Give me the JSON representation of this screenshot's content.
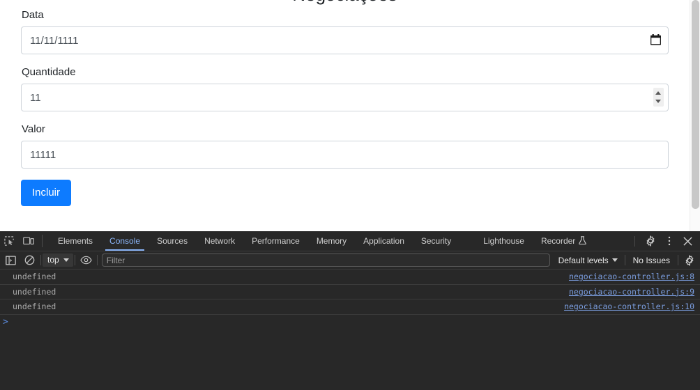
{
  "page": {
    "title": "Negociações",
    "form": {
      "fields": [
        {
          "label": "Data",
          "value": "11/11/1111",
          "icon": "calendar-icon",
          "type": "date"
        },
        {
          "label": "Quantidade",
          "value": "11",
          "icon": "spinner-icon",
          "type": "number"
        },
        {
          "label": "Valor",
          "value": "11111",
          "icon": "",
          "type": "text"
        }
      ],
      "submit_label": "Incluir",
      "submit_color": "#0d7bff"
    }
  },
  "devtools": {
    "left_icons": [
      {
        "name": "inspect-element-icon"
      },
      {
        "name": "device-toolbar-icon"
      }
    ],
    "tabs": [
      {
        "label": "Elements",
        "active": false
      },
      {
        "label": "Console",
        "active": true
      },
      {
        "label": "Sources",
        "active": false
      },
      {
        "label": "Network",
        "active": false
      },
      {
        "label": "Performance",
        "active": false
      },
      {
        "label": "Memory",
        "active": false
      },
      {
        "label": "Application",
        "active": false
      },
      {
        "label": "Security",
        "active": false
      },
      {
        "label": "Lighthouse",
        "active": false
      },
      {
        "label": "Recorder",
        "active": false,
        "badge": "flask-icon"
      }
    ],
    "tabbar_right_icons": [
      {
        "name": "settings-gear-icon"
      },
      {
        "name": "more-options-icon"
      },
      {
        "name": "close-devtools-icon"
      }
    ],
    "toolbar": {
      "sidebar_toggle": "console-sidebar-icon",
      "clear_console": "clear-console-icon",
      "context": "top",
      "live_expression": "eye-icon",
      "filter_placeholder": "Filter",
      "filter_value": "",
      "levels_label": "Default levels",
      "issues_label": "No Issues",
      "issues_gear": "issues-settings-icon"
    },
    "console": {
      "messages": [
        {
          "text": "undefined",
          "source": "negociacao-controller.js:8"
        },
        {
          "text": "undefined",
          "source": "negociacao-controller.js:9"
        },
        {
          "text": "undefined",
          "source": "negociacao-controller.js:10"
        }
      ],
      "prompt": ">"
    },
    "accent_color": "#8ab4f8",
    "background_color": "#282828"
  }
}
